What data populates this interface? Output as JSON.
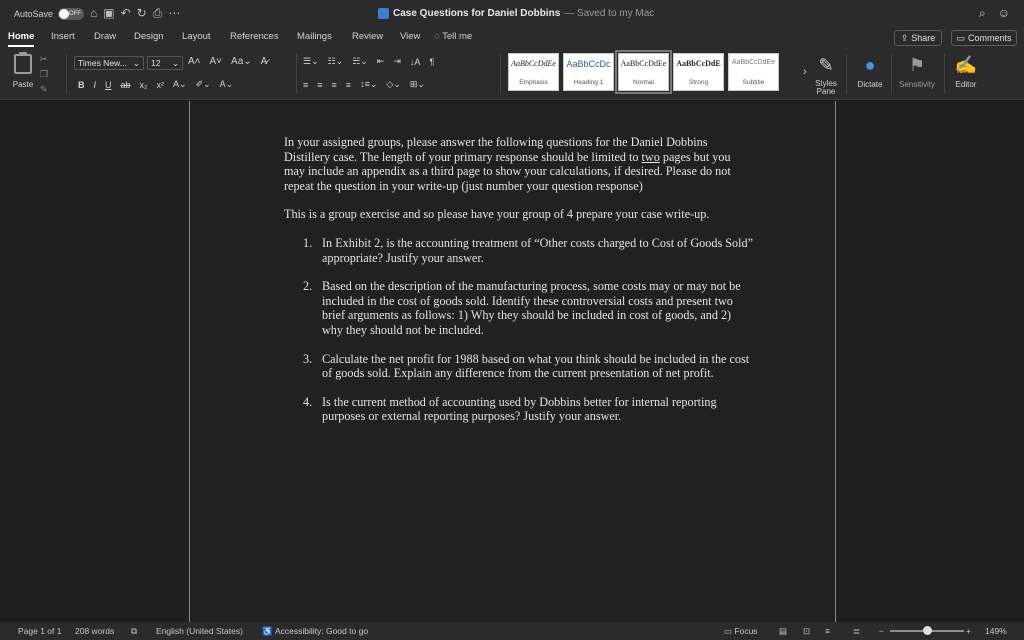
{
  "titlebar": {
    "autosave_label": "AutoSave",
    "autosave_state": "OFF",
    "document_title": "Case Questions for Daniel Dobbins",
    "save_status": "— Saved to my Mac"
  },
  "tabs": [
    "Home",
    "Insert",
    "Draw",
    "Design",
    "Layout",
    "References",
    "Mailings",
    "Review",
    "View"
  ],
  "tell_me": "Tell me",
  "share_label": "Share",
  "comments_label": "Comments",
  "ribbon": {
    "paste_label": "Paste",
    "font_name": "Times New...",
    "font_size": "12",
    "styles": [
      {
        "sample": "AaBbCcDdEe",
        "name": "Emphasis"
      },
      {
        "sample": "AaBbCcDc",
        "name": "Heading 1"
      },
      {
        "sample": "AaBbCcDdEe",
        "name": "Normal"
      },
      {
        "sample": "AaBbCcDdE",
        "name": "Strong"
      },
      {
        "sample": "AaBbCcDdEe",
        "name": "Subtitle"
      }
    ],
    "styles_pane_label": "Styles Pane",
    "dictate_label": "Dictate",
    "sensitivity_label": "Sensitivity",
    "editor_label": "Editor"
  },
  "document": {
    "intro_1": "In your assigned groups, please answer the following questions for the Daniel Dobbins Distillery case.  The length of your primary response should be limited to ",
    "intro_underlined": "two",
    "intro_2": " pages but you may include an appendix as a third page to show your calculations, if desired.  Please do not repeat the question in your write-up (just number your question response)",
    "group_note": "This is a group exercise and so please have your group of 4 prepare your case write-up.",
    "questions": [
      {
        "num": "1.",
        "text": "In Exhibit 2, is the accounting treatment of “Other costs charged to Cost of Goods Sold” appropriate? Justify your answer."
      },
      {
        "num": "2.",
        "text": "Based on the description of the manufacturing process, some costs may or may not be included in the cost of goods sold.  Identify these controversial costs and present two brief arguments as follows: 1) Why they should be included in cost of goods, and 2) why they should not be included."
      },
      {
        "num": "3.",
        "text": "Calculate the net profit for 1988 based on what you think should be included in the cost of goods sold.  Explain any difference from the current presentation of net profit."
      },
      {
        "num": "4.",
        "text": "Is the current method of accounting used by Dobbins better for internal reporting purposes or external reporting purposes?  Justify your answer."
      }
    ]
  },
  "statusbar": {
    "page": "Page 1 of 1",
    "words": "208 words",
    "language": "English (United States)",
    "accessibility": "Accessibility: Good to go",
    "focus": "Focus",
    "zoom": "149%",
    "zoom_level_percent": 50
  }
}
